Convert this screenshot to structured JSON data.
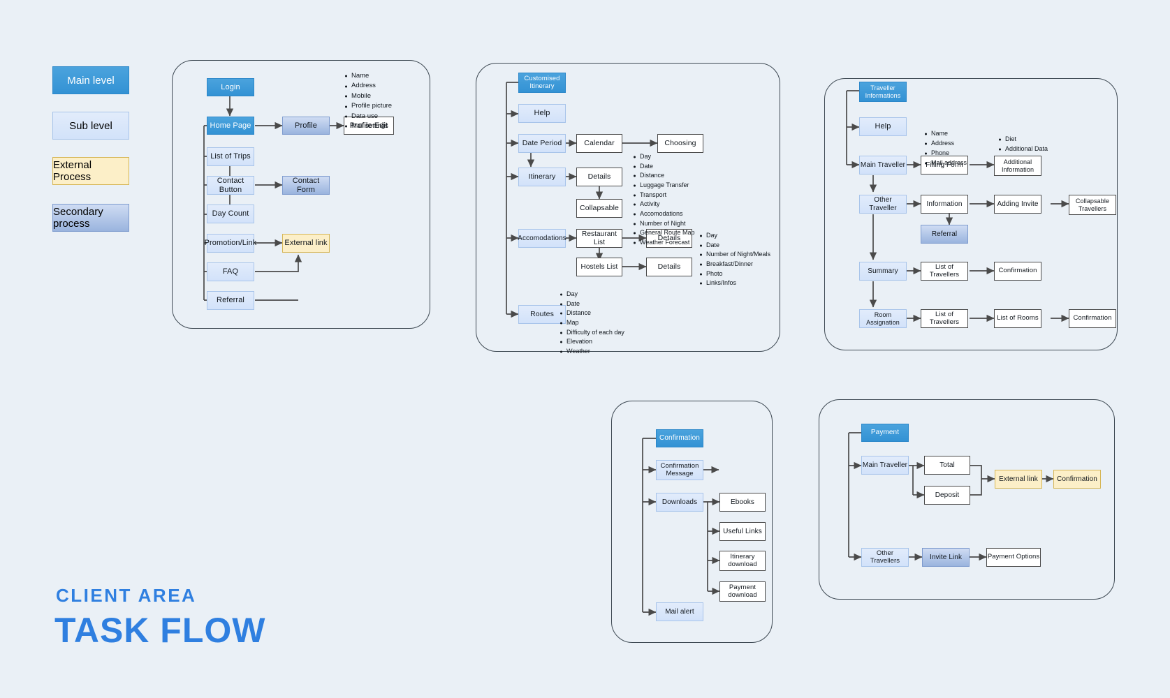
{
  "title": {
    "small": "CLIENT AREA",
    "large": "TASK FLOW",
    "accent": "#2f7fe0"
  },
  "legend": {
    "items": [
      {
        "label": "Main level",
        "type": "main",
        "color": "#3392d4"
      },
      {
        "label": "Sub level",
        "type": "sub",
        "color": "#d2e2fa"
      },
      {
        "label": "External Process",
        "type": "external",
        "color": "#fcefc8"
      },
      {
        "label": "Secondary process",
        "type": "secondary",
        "color": "#9ab4de"
      }
    ]
  },
  "panels": [
    {
      "id": "home",
      "nodes": [
        {
          "name": "login",
          "label": "Login",
          "type": "main"
        },
        {
          "name": "home-page",
          "label": "Home Page",
          "type": "main"
        },
        {
          "name": "profile",
          "label": "Profile",
          "type": "secondary"
        },
        {
          "name": "profile-edit",
          "label": "Profile Edit",
          "type": "plain"
        },
        {
          "name": "list-of-trips",
          "label": "List of Trips",
          "type": "sub"
        },
        {
          "name": "contact-button",
          "label": "Contact Button",
          "type": "sub"
        },
        {
          "name": "contact-form",
          "label": "Contact Form",
          "type": "secondary"
        },
        {
          "name": "day-count",
          "label": "Day Count",
          "type": "sub"
        },
        {
          "name": "promotion-link",
          "label": "Promotion/Link",
          "type": "sub"
        },
        {
          "name": "external-link",
          "label": "External link",
          "type": "external"
        },
        {
          "name": "faq",
          "label": "FAQ",
          "type": "sub"
        },
        {
          "name": "referral",
          "label": "Referral",
          "type": "sub"
        }
      ],
      "bullets": [
        {
          "name": "profile-fields",
          "items": [
            "Name",
            "Address",
            "Mobile",
            "Profile picture",
            "Data use",
            "Mail settings"
          ]
        }
      ]
    },
    {
      "id": "itinerary",
      "nodes": [
        {
          "name": "customised-itinerary",
          "label": "Customised Itinerary",
          "type": "main"
        },
        {
          "name": "help",
          "label": "Help",
          "type": "sub"
        },
        {
          "name": "date-period",
          "label": "Date Period",
          "type": "sub"
        },
        {
          "name": "calendar",
          "label": "Calendar",
          "type": "plain"
        },
        {
          "name": "choosing",
          "label": "Choosing",
          "type": "plain"
        },
        {
          "name": "itinerary",
          "label": "Itinerary",
          "type": "sub"
        },
        {
          "name": "details-itin",
          "label": "Details",
          "type": "plain"
        },
        {
          "name": "collapsable",
          "label": "Collapsable",
          "type": "plain"
        },
        {
          "name": "accomodations",
          "label": "Accomodations",
          "type": "sub"
        },
        {
          "name": "restaurant-list",
          "label": "Restaurant List",
          "type": "plain"
        },
        {
          "name": "details-rest",
          "label": "Details",
          "type": "plain"
        },
        {
          "name": "hostels-list",
          "label": "Hostels List",
          "type": "plain"
        },
        {
          "name": "details-host",
          "label": "Details",
          "type": "plain"
        },
        {
          "name": "routes",
          "label": "Routes",
          "type": "sub"
        }
      ],
      "bullets": [
        {
          "name": "itinerary-details-fields",
          "items": [
            "Day",
            "Date",
            "Distance",
            "Luggage Transfer",
            "Transport",
            "Activity",
            "Accomodations",
            "Number of Night",
            "General Route Map",
            "Weather Forecast"
          ]
        },
        {
          "name": "accomodation-details-fields",
          "items": [
            "Day",
            "Date",
            "Number of Night/Meals",
            "Breakfast/Dinner",
            "Photo",
            "Links/Infos"
          ]
        },
        {
          "name": "routes-fields",
          "items": [
            "Day",
            "Date",
            "Distance",
            "Map",
            "Difficulty of each day",
            "Elevation",
            "Weather"
          ]
        }
      ]
    },
    {
      "id": "traveller",
      "nodes": [
        {
          "name": "traveller-informations",
          "label": "Traveller Informations",
          "type": "main"
        },
        {
          "name": "help-2",
          "label": "Help",
          "type": "sub"
        },
        {
          "name": "main-traveller",
          "label": "Main Traveller",
          "type": "sub"
        },
        {
          "name": "filling-form",
          "label": "Filling Form",
          "type": "plain"
        },
        {
          "name": "additional-information",
          "label": "Additional Information",
          "type": "plain"
        },
        {
          "name": "other-traveller",
          "label": "Other Traveller",
          "type": "sub"
        },
        {
          "name": "information",
          "label": "Information",
          "type": "plain"
        },
        {
          "name": "adding-invite",
          "label": "Adding Invite",
          "type": "plain"
        },
        {
          "name": "collapsable-travellers",
          "label": "Collapsable Travellers",
          "type": "plain"
        },
        {
          "name": "referral-2",
          "label": "Referral",
          "type": "secondary"
        },
        {
          "name": "summary",
          "label": "Summary",
          "type": "sub"
        },
        {
          "name": "list-of-travellers-1",
          "label": "List of Travellers",
          "type": "plain"
        },
        {
          "name": "confirmation-1",
          "label": "Confirmation",
          "type": "plain"
        },
        {
          "name": "room-assignation",
          "label": "Room Assignation",
          "type": "sub"
        },
        {
          "name": "list-of-travellers-2",
          "label": "List of Travellers",
          "type": "plain"
        },
        {
          "name": "list-of-rooms",
          "label": "List of Rooms",
          "type": "plain"
        },
        {
          "name": "confirmation-2",
          "label": "Confirmation",
          "type": "plain"
        }
      ],
      "bullets": [
        {
          "name": "filling-form-fields",
          "items": [
            "Name",
            "Address",
            "Phone",
            "Mail address"
          ]
        },
        {
          "name": "additional-info-fields",
          "items": [
            "Diet",
            "Additional Data"
          ]
        }
      ]
    },
    {
      "id": "confirmation",
      "nodes": [
        {
          "name": "confirmation-root",
          "label": "Confirmation",
          "type": "main"
        },
        {
          "name": "confirmation-message",
          "label": "Confirmation Message",
          "type": "sub"
        },
        {
          "name": "downloads",
          "label": "Downloads",
          "type": "sub"
        },
        {
          "name": "ebooks",
          "label": "Ebooks",
          "type": "plain"
        },
        {
          "name": "useful-links",
          "label": "Useful Links",
          "type": "plain"
        },
        {
          "name": "itinerary-download",
          "label": "Itinerary download",
          "type": "plain"
        },
        {
          "name": "payment-download",
          "label": "Payment download",
          "type": "plain"
        },
        {
          "name": "mail-alert",
          "label": "Mail alert",
          "type": "sub"
        }
      ],
      "bullets": []
    },
    {
      "id": "payment",
      "nodes": [
        {
          "name": "payment-root",
          "label": "Payment",
          "type": "main"
        },
        {
          "name": "main-traveller-2",
          "label": "Main Traveller",
          "type": "sub"
        },
        {
          "name": "total",
          "label": "Total",
          "type": "plain"
        },
        {
          "name": "deposit",
          "label": "Deposit",
          "type": "plain"
        },
        {
          "name": "external-link-2",
          "label": "External link",
          "type": "external"
        },
        {
          "name": "confirmation-3",
          "label": "Confirmation",
          "type": "external"
        },
        {
          "name": "other-travellers",
          "label": "Other Travellers",
          "type": "sub"
        },
        {
          "name": "invite-link",
          "label": "Invite Link",
          "type": "secondary"
        },
        {
          "name": "payment-options",
          "label": "Payment Options",
          "type": "plain"
        }
      ],
      "bullets": []
    }
  ]
}
